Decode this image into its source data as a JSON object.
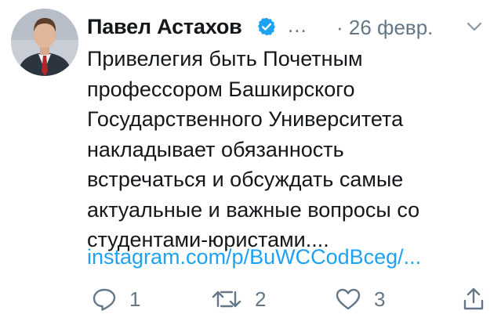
{
  "tweet": {
    "author": {
      "name": "Павел Астахов",
      "verified": true,
      "handle": "..."
    },
    "separator": "·",
    "date": "26 февр.",
    "text": "Привелегия быть Почетным\nпрофессором Башкирского\nГосударственного Университета\nнакладывает обязанность\nвстречаться и обсуждать самые\nактуальные и важные вопросы со\nстудентами-юристами....",
    "link": "instagram.com/p/BuWCCodBceg/...",
    "actions": {
      "reply": {
        "icon": "reply-icon",
        "count": "1"
      },
      "retweet": {
        "icon": "retweet-icon",
        "count": "2"
      },
      "like": {
        "icon": "heart-icon",
        "count": "3"
      },
      "share": {
        "icon": "share-icon"
      }
    }
  },
  "colors": {
    "text": "#14171a",
    "muted": "#657786",
    "link": "#1da1f2",
    "verified": "#1da1f2"
  }
}
